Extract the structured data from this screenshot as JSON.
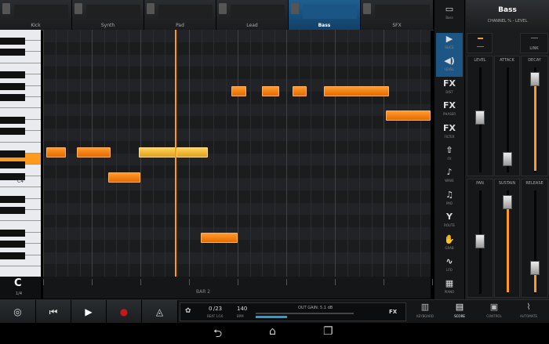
{
  "tracks": [
    {
      "label": "Kick",
      "selected": false
    },
    {
      "label": "Synth",
      "selected": false
    },
    {
      "label": "Pad",
      "selected": false
    },
    {
      "label": "Lead",
      "selected": false
    },
    {
      "label": "Bass",
      "selected": true
    },
    {
      "label": "SFX",
      "selected": false
    }
  ],
  "piano": {
    "c4_label": "C4"
  },
  "ruler": {
    "bar_label": "BAR 2"
  },
  "zoom": {
    "value": "1/4"
  },
  "tools": [
    {
      "icon": "▶",
      "label": "SLICE"
    },
    {
      "icon": "◀)",
      "label": "LEVEL"
    },
    {
      "icon": "FX",
      "label": "DIST"
    },
    {
      "icon": "FX",
      "label": "PHASER"
    },
    {
      "icon": "FX",
      "label": "FILTER"
    },
    {
      "icon": "⇧",
      "label": "FX"
    },
    {
      "icon": "♪",
      "label": "WAVE"
    },
    {
      "icon": "♫",
      "label": "PAD"
    },
    {
      "icon": "Y",
      "label": "ROUTE"
    },
    {
      "icon": "✋",
      "label": "GRAB"
    },
    {
      "icon": "∿",
      "label": "LFO"
    },
    {
      "icon": "▦",
      "label": "PIANO"
    }
  ],
  "channel": {
    "title": "Bass",
    "subtitle": "CHANNEL % - LEVEL",
    "link_label": "LINK"
  },
  "faders": {
    "level": {
      "label": "LEVEL",
      "value": 0.52
    },
    "attack": {
      "label": "ATTACK",
      "value": 0.05
    },
    "decay": {
      "label": "DECAY",
      "value": 0.95
    },
    "pan": {
      "label": "PAN",
      "value": 0.5
    },
    "sustain": {
      "label": "SUSTAIN",
      "value": 0.95
    },
    "release": {
      "label": "RELEASE",
      "value": 0.2
    }
  },
  "transport": {
    "time": "0 /23",
    "time_sub": "BEAT 1/16",
    "tempo": "140",
    "tempo_sub": "BPM",
    "out_gain": "OUT GAIN: 5.1 dB",
    "fx_label": "FX",
    "views": [
      "KEYBOARD",
      "SCORE",
      "CONTROL",
      "AUTOMATE"
    ]
  },
  "colors": {
    "accent": "#ff9a1e",
    "selected_blue": "#1d5585"
  }
}
